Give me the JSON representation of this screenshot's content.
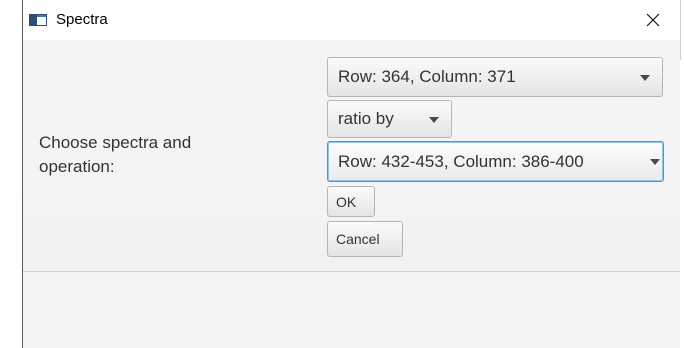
{
  "window": {
    "title": "Spectra",
    "close_glyph": "✕",
    "icons": {
      "app": "app-window-icon",
      "close": "close-icon"
    }
  },
  "dialog": {
    "prompt": "Choose spectra and operation:",
    "first_spectrum": {
      "selected": "Row: 364, Column: 371"
    },
    "operation": {
      "selected": "ratio by"
    },
    "second_spectrum": {
      "selected": "Row: 432-453, Column: 386-400"
    },
    "ok_label": "OK",
    "cancel_label": "Cancel"
  },
  "colors": {
    "focus_accent": "#3d9cd9",
    "icon_blue": "#2e4d79"
  }
}
